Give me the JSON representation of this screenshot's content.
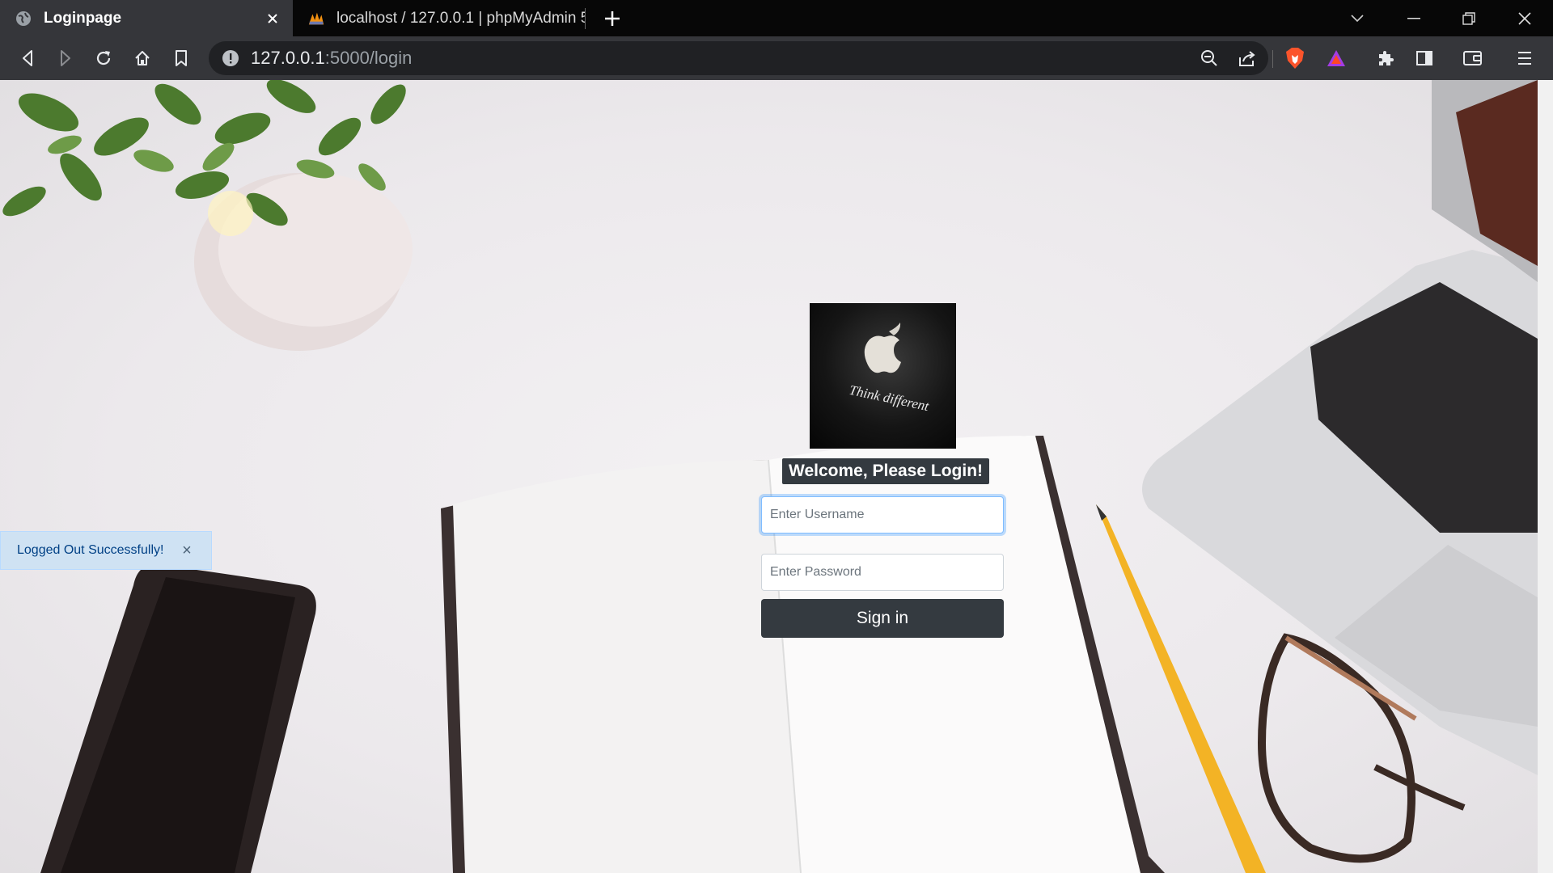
{
  "browser": {
    "tabs": [
      {
        "title": "Loginpage",
        "icon": "globe-icon",
        "active": true
      },
      {
        "title": "localhost / 127.0.0.1 | phpMyAdmin 5.",
        "icon": "phpmyadmin-icon",
        "active": false
      }
    ],
    "url_host": "127.0.0.1",
    "url_rest": ":5000/login"
  },
  "alert": {
    "message": "Logged Out Successfully!",
    "close": "×"
  },
  "login": {
    "logo_tagline": "Think different",
    "welcome": "Welcome, Please Login!",
    "username_placeholder": "Enter Username",
    "password_placeholder": "Enter Password",
    "signin_label": "Sign in"
  }
}
